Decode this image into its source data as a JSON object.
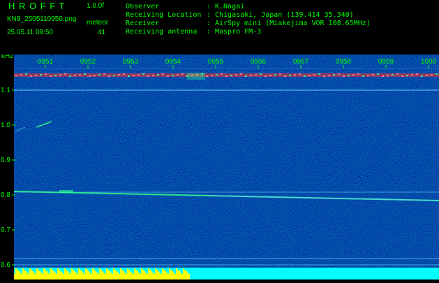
{
  "header": {
    "app_name": "H R O F F T",
    "version": "1.0.0f",
    "filename": "KN9_2505110950.png",
    "datetime": "25.05.11 09:50",
    "meteor_label": "meteor",
    "meteor_count": "41",
    "info": [
      {
        "label": "Observer",
        "sep": ":",
        "value": "K.Nagai"
      },
      {
        "label": "Receiving Location",
        "sep": ":",
        "value": "Chigasaki, Japan (139.414 35.340)"
      },
      {
        "label": "Receiver",
        "sep": ":",
        "value": "AirSpy mini (Miakejima VOR 108.65MHz)"
      },
      {
        "label": "Receiving antenna",
        "sep": ":",
        "value": "Maspro FM-3"
      }
    ]
  },
  "spectrogram": {
    "unit_label": "kHz",
    "time_labels": [
      "0951",
      "0952",
      "0953",
      "0954",
      "0955",
      "0956",
      "0957",
      "0958",
      "0959",
      "1000"
    ],
    "freq_labels": [
      "1.1",
      "1.0",
      "0.9",
      "0.8",
      "0.7",
      "0.6"
    ],
    "freq_values": [
      1.1,
      1.0,
      0.9,
      0.8,
      0.7,
      0.6
    ],
    "colors": {
      "background": "#0a1a8c",
      "text": "#00ff00",
      "carrier": "#ff3030",
      "line": "#60d0ff",
      "meteor": "#30ff90",
      "bottom_bar_yellow": "#ffff00",
      "bottom_bar_cyan": "#00ffff"
    }
  }
}
